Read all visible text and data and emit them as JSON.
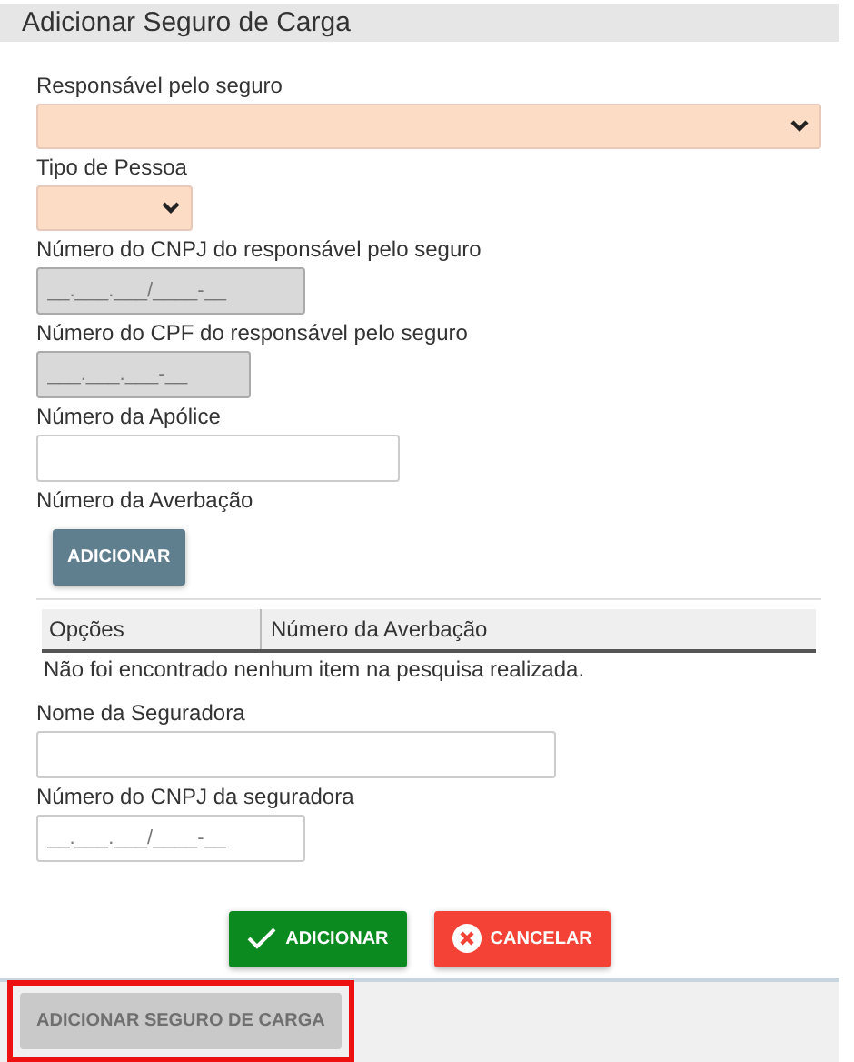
{
  "dialog": {
    "title": "Adicionar Seguro de Carga"
  },
  "items": [
    {
      "kind": "select",
      "label": "Responsável pelo seguro",
      "required": true,
      "disabled": false
    },
    {
      "kind": "select",
      "label": "Tipo de Pessoa",
      "required": true,
      "disabled": false
    },
    {
      "kind": "input",
      "label": "Número do CNPJ do responsável pelo seguro",
      "placeholder": "__.___.___/____-__",
      "disabled": true
    },
    {
      "kind": "input",
      "label": "Número do CPF do responsável pelo seguro",
      "placeholder": "___.___.___-__",
      "disabled": true
    },
    {
      "kind": "input",
      "label": "Número da Apólice",
      "disabled": false
    },
    {
      "kind": "add",
      "label": "Número da Averbação",
      "button": "ADICIONAR"
    },
    {
      "kind": "table",
      "columns": [
        "Opções",
        "Número da Averbação"
      ],
      "empty_message": "Não foi encontrado nenhum item na pesquisa realizada."
    },
    {
      "kind": "input",
      "label": "Nome da Seguradora",
      "disabled": false
    },
    {
      "kind": "input",
      "label": "Número do CNPJ da seguradora",
      "placeholder": "__.___.___/____-__",
      "disabled": false
    }
  ],
  "actions": [
    {
      "kind": "confirm",
      "label": "ADICIONAR"
    },
    {
      "kind": "cancel",
      "label": "CANCELAR"
    }
  ],
  "footer": {
    "button": "ADICIONAR SEGURO DE CARGA",
    "disabled": true,
    "highlighted": true
  }
}
